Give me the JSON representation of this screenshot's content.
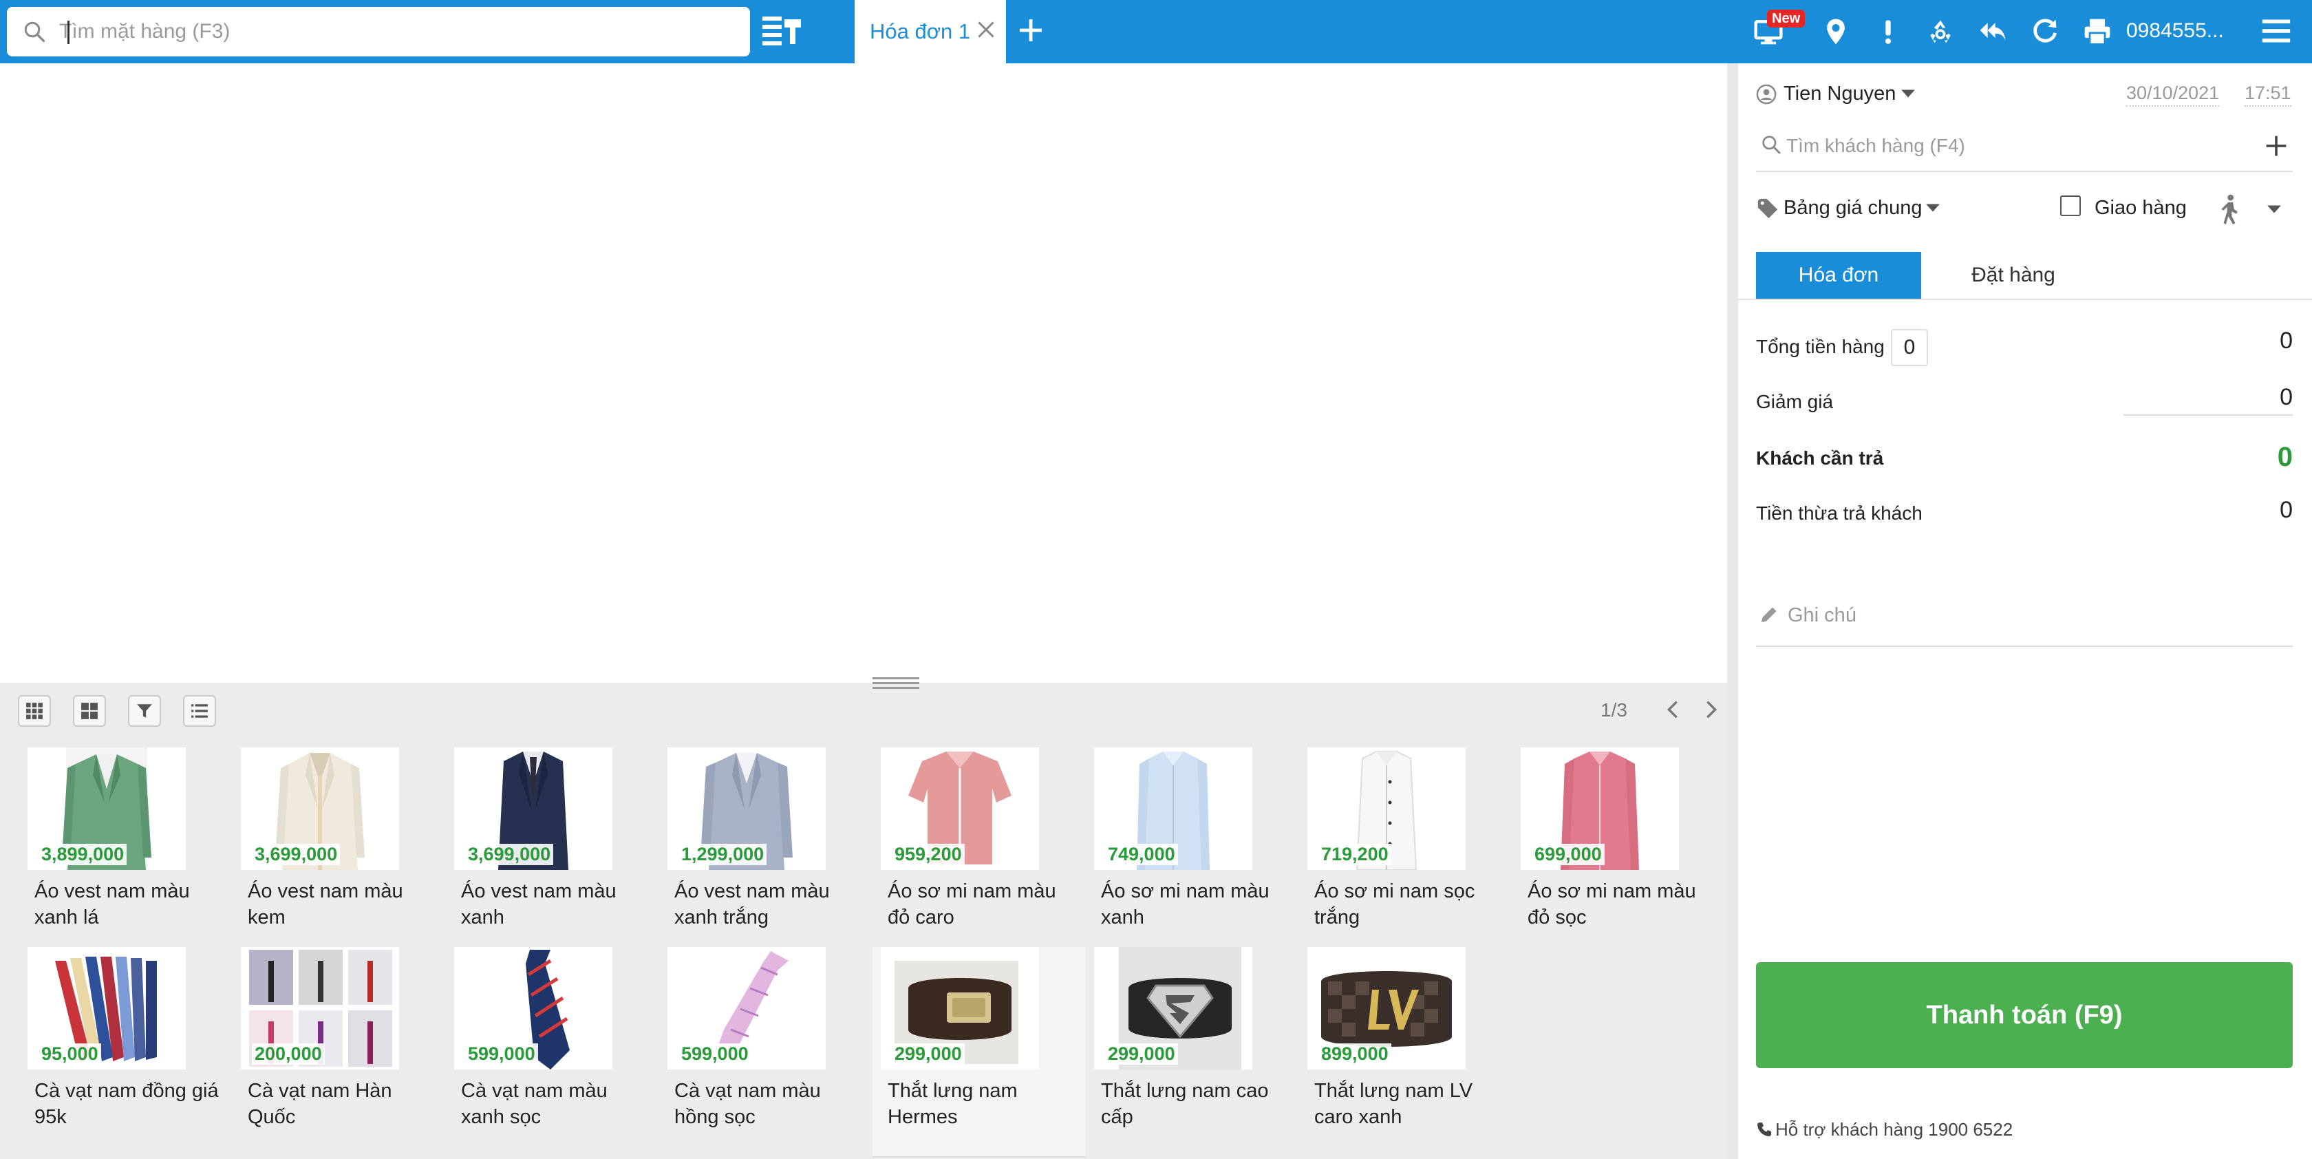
{
  "topbar": {
    "search_placeholder": "Tìm mặt hàng (F3)",
    "tab_label": "Hóa đơn 1",
    "badge_new": "New",
    "phone": "0984555...",
    "accent_color": "#1a8dd8"
  },
  "toolbar": {
    "page": "1/3"
  },
  "products": [
    {
      "name": "Áo vest nam màu xanh lá",
      "price": "3,899,000",
      "image": "green-suit"
    },
    {
      "name": "Áo vest nam màu kem",
      "price": "3,699,000",
      "image": "cream-suit"
    },
    {
      "name": "Áo vest nam màu xanh",
      "price": "3,699,000",
      "image": "navy-suit"
    },
    {
      "name": "Áo vest nam màu xanh trắng",
      "price": "1,299,000",
      "image": "grey-blue-suit"
    },
    {
      "name": "Áo sơ mi nam màu đỏ caro",
      "price": "959,200",
      "image": "red-check-shirt"
    },
    {
      "name": "Áo sơ mi nam màu xanh",
      "price": "749,000",
      "image": "blue-shirt"
    },
    {
      "name": "Áo sơ mi nam sọc trắng",
      "price": "719,200",
      "image": "white-shirt"
    },
    {
      "name": "Áo sơ mi nam màu đỏ sọc",
      "price": "699,000",
      "image": "red-striped-shirt"
    },
    {
      "name": "Cà vạt nam đồng giá 95k",
      "price": "95,000",
      "image": "ties-fan"
    },
    {
      "name": "Cà vạt nam Hàn Quốc",
      "price": "200,000",
      "image": "ties-grid"
    },
    {
      "name": "Cà vạt nam màu xanh sọc",
      "price": "599,000",
      "image": "navy-striped-tie"
    },
    {
      "name": "Cà vạt nam màu hồng sọc",
      "price": "599,000",
      "image": "pink-striped-tie"
    },
    {
      "name": "Thắt lưng nam Hermes",
      "price": "299,000",
      "image": "hermes-belt"
    },
    {
      "name": "Thắt lưng nam cao cấp",
      "price": "299,000",
      "image": "superman-belt"
    },
    {
      "name": "Thắt lưng nam LV caro xanh",
      "price": "899,000",
      "image": "lv-belt"
    }
  ],
  "right_panel": {
    "user": "Tien Nguyen",
    "date": "30/10/2021",
    "time": "17:51",
    "customer_placeholder": "Tìm khách hàng (F4)",
    "price_list": "Bảng giá chung",
    "shipping_label": "Giao hàng",
    "tab_invoice": "Hóa đơn",
    "tab_order": "Đặt hàng",
    "total_label": "Tổng tiền hàng",
    "total_qty": "0",
    "total_value": "0",
    "discount_label": "Giảm giá",
    "discount_value": "0",
    "pay_label": "Khách cần trả",
    "pay_value": "0",
    "change_label": "Tiền thừa trả khách",
    "change_value": "0",
    "note_placeholder": "Ghi chú",
    "pay_button": "Thanh toán (F9)",
    "support": "Hỗ trợ khách hàng 1900 6522",
    "pay_color": "#4caf50",
    "total_color": "#2a9a3a"
  }
}
